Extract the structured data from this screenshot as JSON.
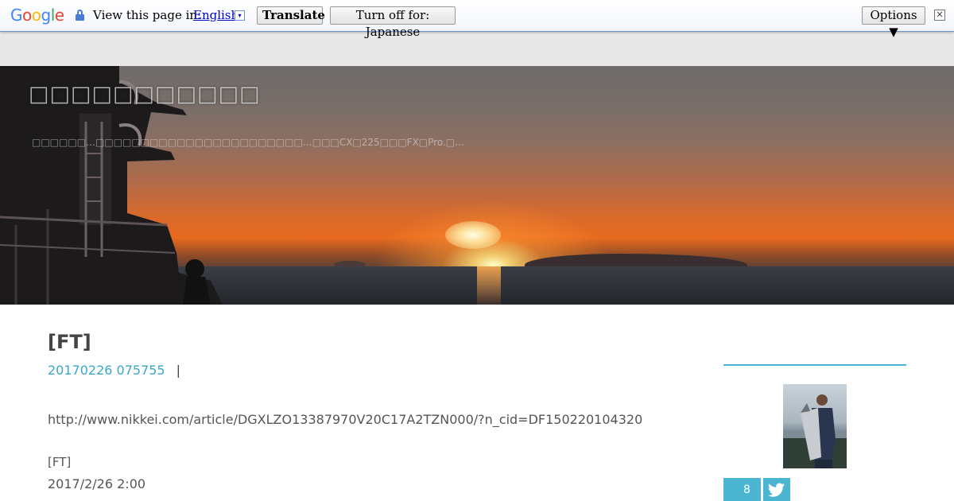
{
  "translate_bar": {
    "logo": [
      "G",
      "o",
      "o",
      "g",
      "l",
      "e"
    ],
    "logo_colors": [
      "#4285f4",
      "#ea4335",
      "#fbbc05",
      "#4285f4",
      "#34a853",
      "#ea4335"
    ],
    "view_label": "View this page in:",
    "language": "English",
    "language_dropdown": "▾",
    "translate_button": "Translate",
    "turn_off_button": "Turn off for: Japanese",
    "options_button": "Options ▼",
    "close_button": "✕"
  },
  "header": {
    "site_title": "□□□□□□□□□□□",
    "site_description": "□□□□□□…□□□□□□□□□□□□□□□□□□□□□□□…□□□CX□225□□□FX□Pro.□…"
  },
  "post": {
    "title": "[FT]",
    "date": "20170226 075755",
    "separator": "|",
    "link": "http://www.nikkei.com/article/DGXLZO13387970V20C17A2TZN000/?n_cid=DF150220104320",
    "line1": "[FT]",
    "line2": "2017/2/26 2:00"
  },
  "sidebar": {
    "share_count": "8",
    "twitter_icon": "twitter-icon"
  },
  "colors": {
    "accent": "#4cb6d2",
    "link_blue": "#3aa8c9"
  }
}
